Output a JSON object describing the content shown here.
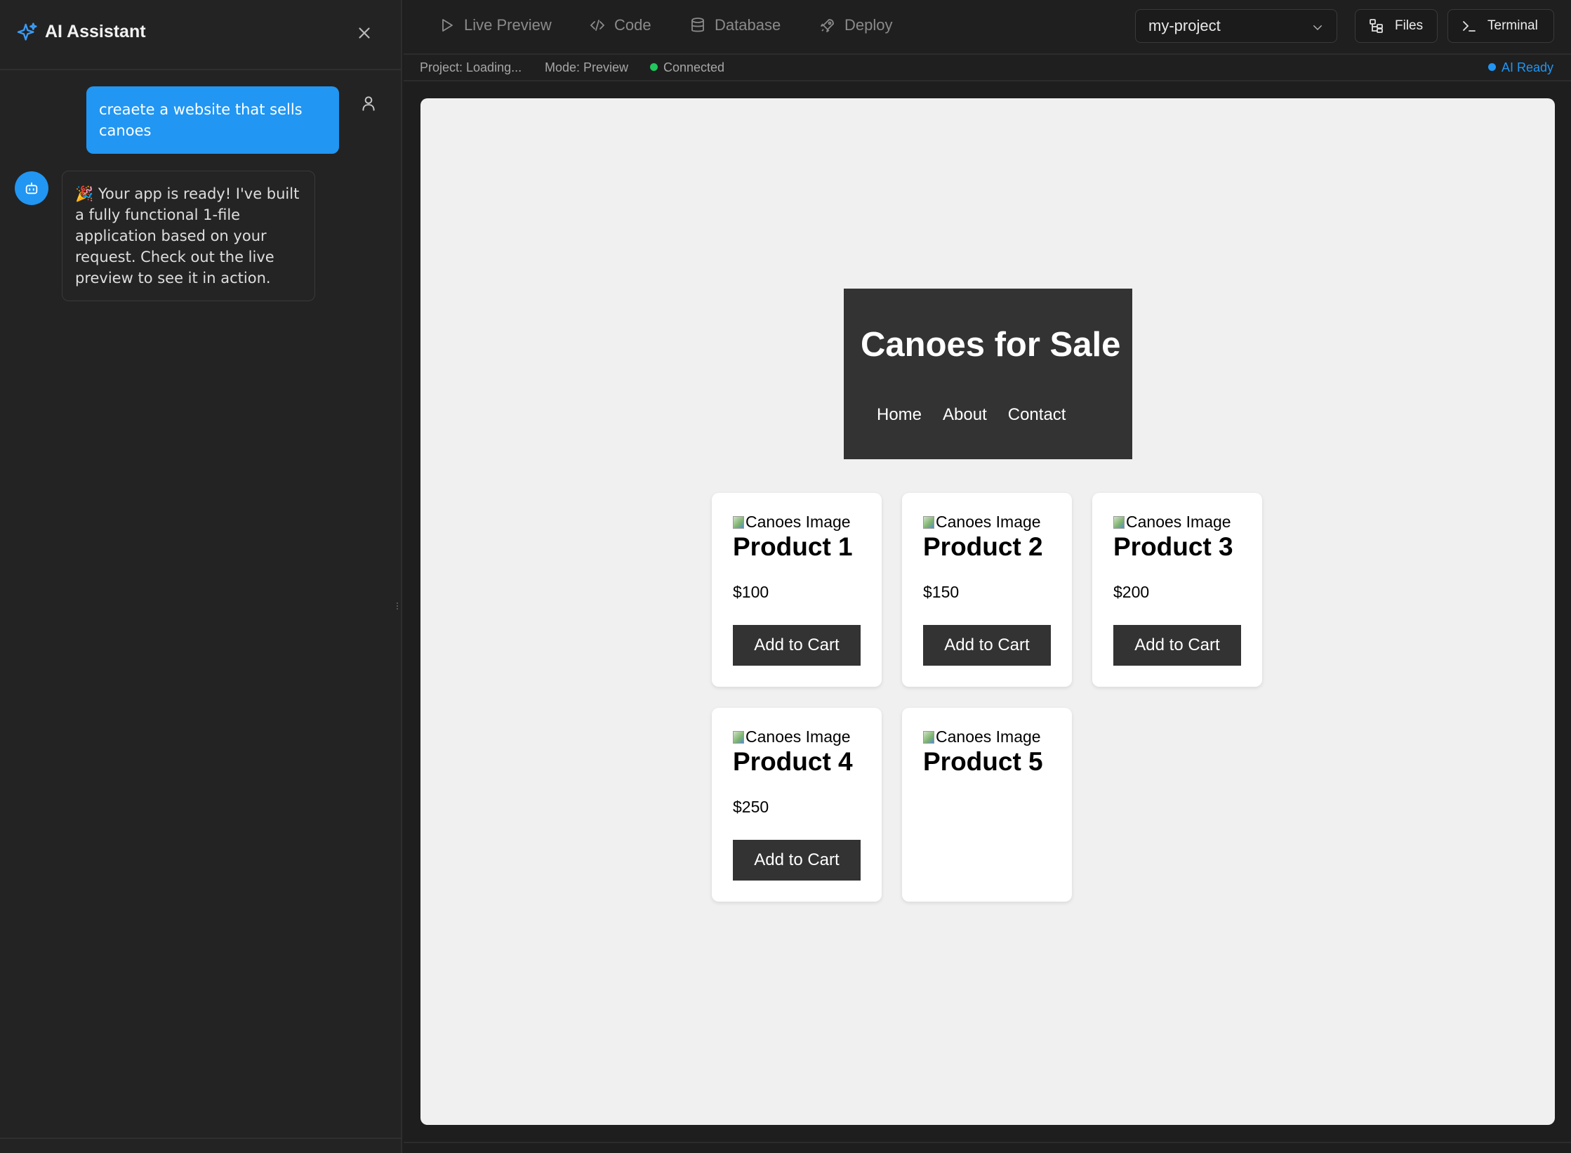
{
  "assistant": {
    "title": "AI Assistant",
    "messages": {
      "user": "creaete a website that sells canoes",
      "bot": "🎉 Your app is ready! I've built a fully functional 1-file application based on your request. Check out the live preview to see it in action."
    }
  },
  "toolbar": {
    "tabs": [
      "Live Preview",
      "Code",
      "Database",
      "Deploy"
    ],
    "project": "my-project",
    "files_label": "Files",
    "terminal_label": "Terminal"
  },
  "status": {
    "project": "Project: Loading...",
    "mode": "Mode: Preview",
    "connection": "Connected",
    "ai": "AI Ready",
    "connected_color": "#22c55e",
    "ai_color": "#2196f3"
  },
  "preview": {
    "site_title": "Canoes for Sale",
    "nav": [
      "Home",
      "About",
      "Contact"
    ],
    "image_alt": "Canoes Image",
    "products": [
      {
        "name": "Product 1",
        "price": "$100",
        "button": "Add to Cart"
      },
      {
        "name": "Product 2",
        "price": "$150",
        "button": "Add to Cart"
      },
      {
        "name": "Product 3",
        "price": "$200",
        "button": "Add to Cart"
      },
      {
        "name": "Product 4",
        "price": "$250",
        "button": "Add to Cart"
      },
      {
        "name": "Product 5"
      }
    ]
  },
  "icons": {
    "assistant": "sparkles-icon",
    "close": "close-icon",
    "user": "user-icon",
    "bot": "bot-icon",
    "live_preview": "play-icon",
    "code": "code-icon",
    "database": "database-icon",
    "deploy": "rocket-icon",
    "files": "file-tree-icon",
    "terminal": "terminal-icon"
  },
  "colors": {
    "accent": "#2196f3",
    "panel_bg": "#232323",
    "site_header_bg": "#333333"
  }
}
